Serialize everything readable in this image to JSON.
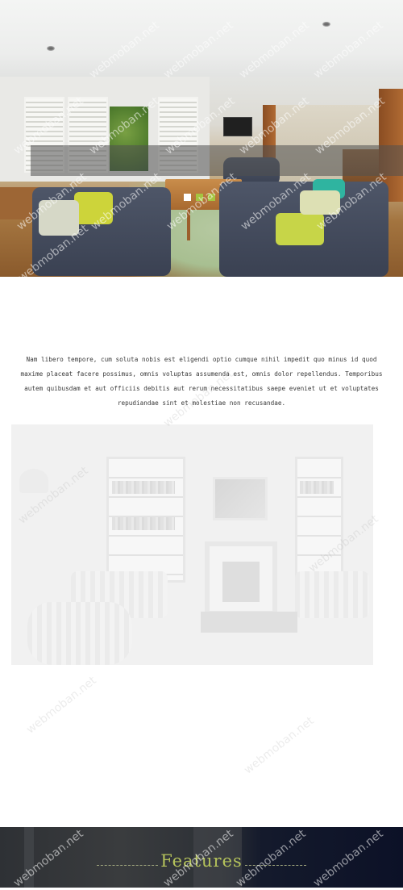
{
  "hero": {
    "slides": [
      {
        "state": "active"
      },
      {
        "state": "inactive"
      },
      {
        "state": "inactive"
      }
    ]
  },
  "intro": {
    "text": "Nam libero tempore, cum soluta nobis est eligendi optio cumque nihil impedit quo minus id quod maxime placeat facere possimus, omnis voluptas assumenda est, omnis dolor repellendus. Temporibus autem quibusdam et aut officiis debitis aut rerum necessitatibus saepe eveniet ut et voluptates repudiandae sint et molestiae non recusandae."
  },
  "features": {
    "title": "Features"
  },
  "watermark": {
    "text": "webmoban.net"
  },
  "colors": {
    "accent": "#a5c440",
    "features_title": "#b4c25b",
    "footer_dark": "#0c1127"
  }
}
